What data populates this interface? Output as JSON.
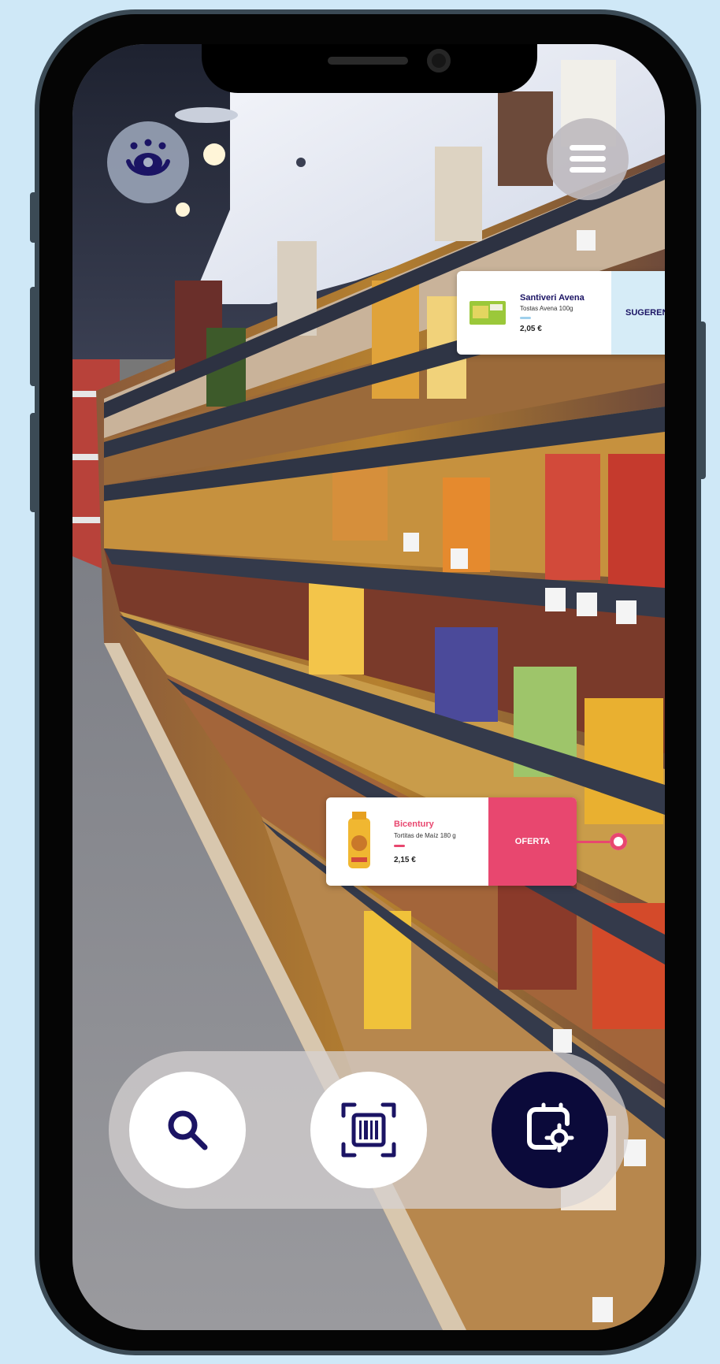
{
  "cards": {
    "suggestion": {
      "name": "Santiveri Avena",
      "description": "Tostas Avena 100g",
      "price": "2,05 €",
      "tag": "SUGEREN"
    },
    "offer": {
      "name": "Bicentury",
      "description": "Tortitas de Maíz 180 g",
      "price": "2,15 €",
      "tag": "OFERTA"
    }
  },
  "colors": {
    "navy": "#1b1464",
    "offer_pink": "#e8476f",
    "suggestion_blue": "#d6ecf7"
  },
  "icons": {
    "logo": "eye-logo-icon",
    "menu": "hamburger-icon",
    "search": "search-icon",
    "scan": "barcode-scan-icon",
    "ar": "ar-scan-icon"
  }
}
